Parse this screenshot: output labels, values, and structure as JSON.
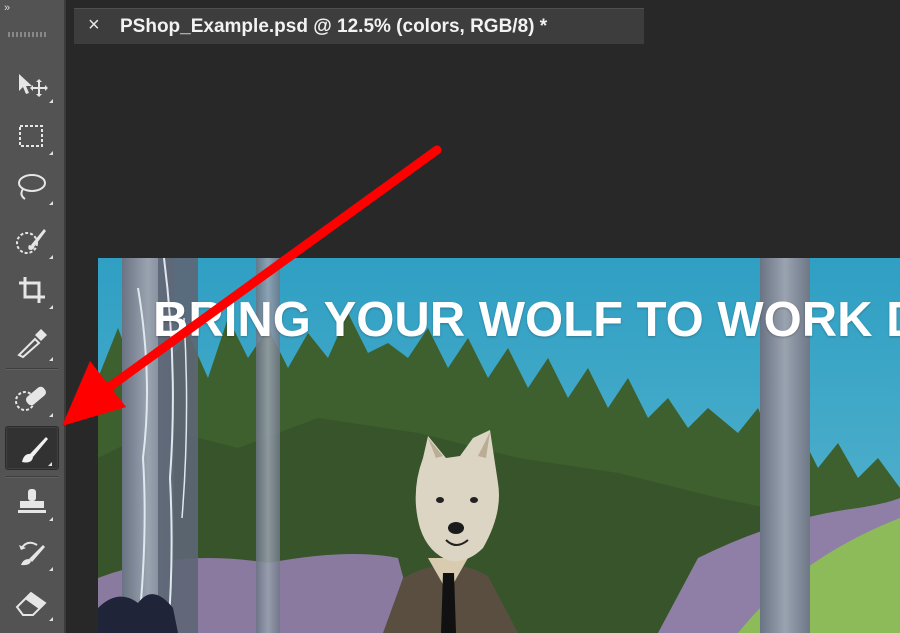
{
  "document_tab": {
    "close_glyph": "×",
    "title": "PShop_Example.psd @ 12.5% (colors, RGB/8) *"
  },
  "toolbar": {
    "collapse_glyph": "»",
    "tools": [
      {
        "name": "move-tool",
        "icon": "move-icon"
      },
      {
        "name": "rectangular-marquee-tool",
        "icon": "marquee-icon"
      },
      {
        "name": "lasso-tool",
        "icon": "lasso-icon"
      },
      {
        "name": "quick-selection-tool",
        "icon": "quick-selection-icon"
      },
      {
        "name": "crop-tool",
        "icon": "crop-icon"
      },
      {
        "name": "eyedropper-tool",
        "icon": "eyedropper-icon"
      },
      {
        "name": "spot-healing-brush-tool",
        "icon": "bandage-icon"
      },
      {
        "name": "brush-tool",
        "icon": "brush-icon",
        "active": true
      },
      {
        "name": "clone-stamp-tool",
        "icon": "stamp-icon"
      },
      {
        "name": "history-brush-tool",
        "icon": "history-brush-icon"
      },
      {
        "name": "eraser-tool",
        "icon": "eraser-icon"
      }
    ]
  },
  "artwork": {
    "headline": "BRING YOUR WOLF TO WORK D"
  },
  "colors": {
    "workspace": "#282828",
    "toolbar": "#535353",
    "sky": "#3aa6c4",
    "forest": "#3f5f30",
    "annotation_arrow": "#ff0000"
  }
}
